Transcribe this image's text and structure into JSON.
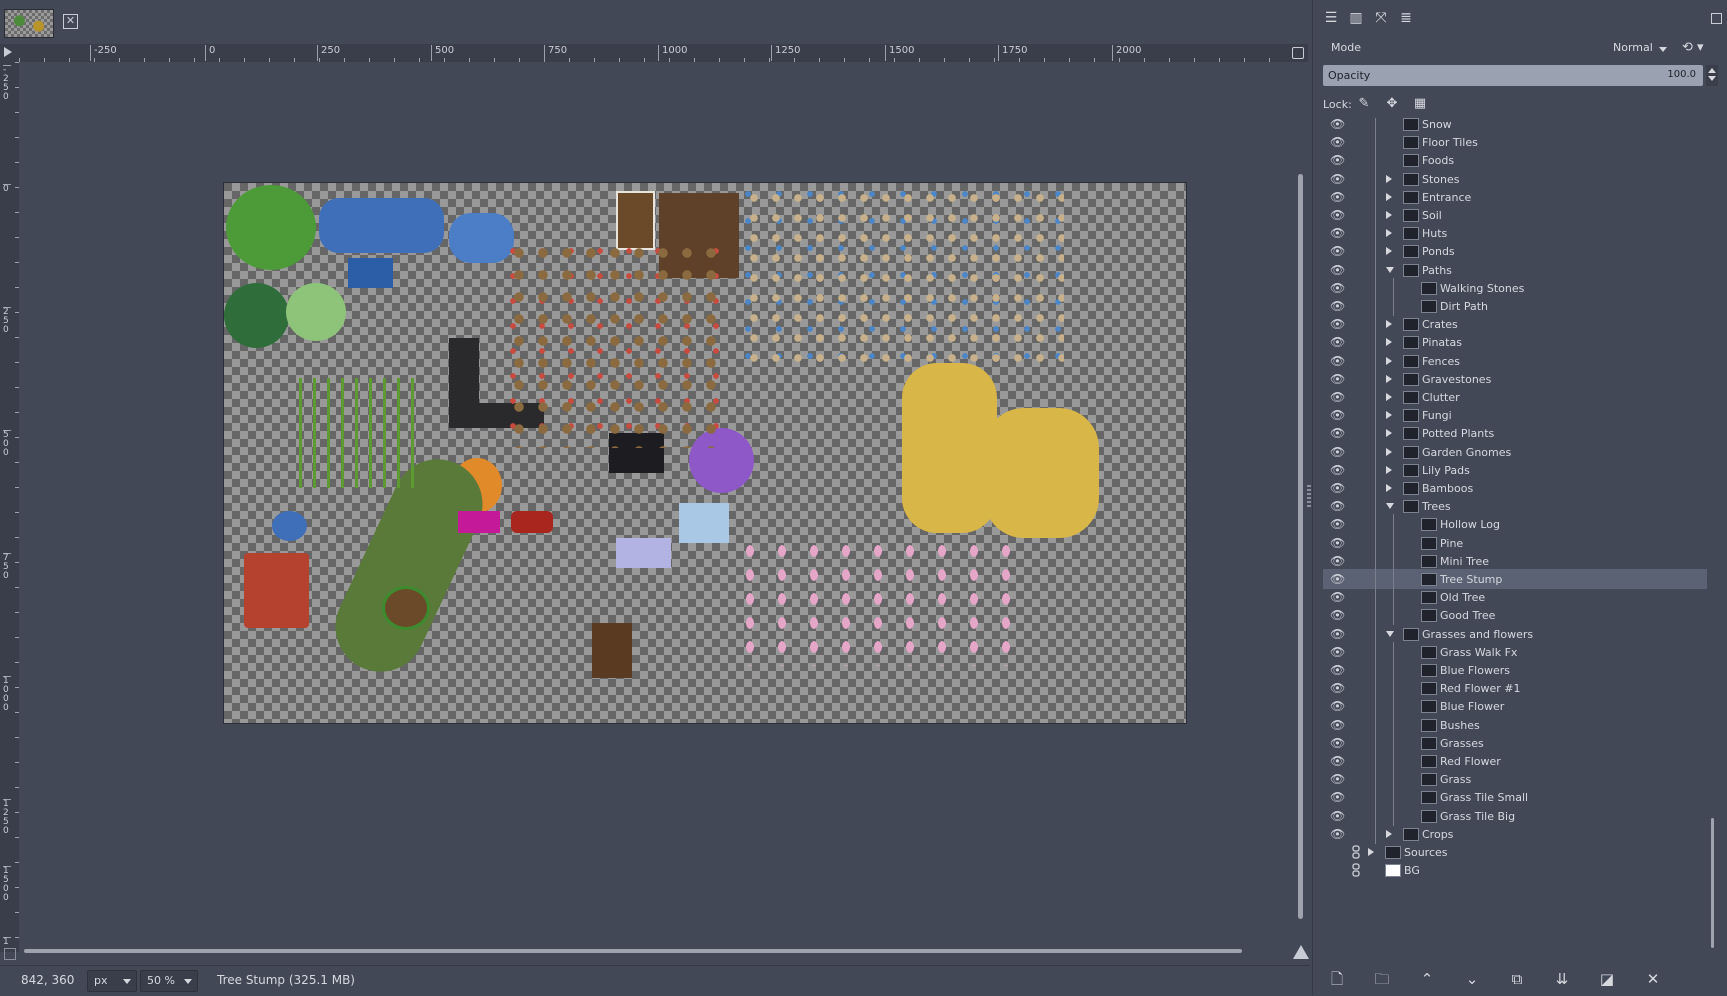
{
  "tab": {
    "close_icon": "close-icon"
  },
  "ruler": {
    "horizontal": [
      "-250",
      "0",
      "250",
      "500",
      "750",
      "1000",
      "1250",
      "1500",
      "1750",
      "2000"
    ],
    "vertical": [
      "-250",
      "0",
      "250",
      "500",
      "750",
      "1000",
      "1250",
      "1500",
      "1"
    ]
  },
  "statusbar": {
    "coords": "842, 360",
    "unit": "px",
    "zoom": "50 %",
    "message": "Tree Stump (325.1 MB)"
  },
  "layers_panel": {
    "mode_label": "Mode",
    "mode_value": "Normal",
    "opacity_label": "Opacity",
    "opacity_value": "100.0",
    "lock_label": "Lock:",
    "layers": [
      {
        "name": "Snow",
        "depth": 1,
        "kind": "layer",
        "expander": "none"
      },
      {
        "name": "Floor Tiles",
        "depth": 1,
        "kind": "layer",
        "expander": "none"
      },
      {
        "name": "Foods",
        "depth": 1,
        "kind": "layer",
        "expander": "none"
      },
      {
        "name": "Stones",
        "depth": 1,
        "kind": "group",
        "expander": "closed"
      },
      {
        "name": "Entrance",
        "depth": 1,
        "kind": "group",
        "expander": "closed"
      },
      {
        "name": "Soil",
        "depth": 1,
        "kind": "group",
        "expander": "closed"
      },
      {
        "name": "Huts",
        "depth": 1,
        "kind": "group",
        "expander": "closed"
      },
      {
        "name": "Ponds",
        "depth": 1,
        "kind": "group",
        "expander": "closed"
      },
      {
        "name": "Paths",
        "depth": 1,
        "kind": "group",
        "expander": "open"
      },
      {
        "name": "Walking Stones",
        "depth": 2,
        "kind": "layer",
        "expander": "none"
      },
      {
        "name": "Dirt Path",
        "depth": 2,
        "kind": "layer",
        "expander": "none"
      },
      {
        "name": "Crates",
        "depth": 1,
        "kind": "group",
        "expander": "closed"
      },
      {
        "name": "Pinatas",
        "depth": 1,
        "kind": "group",
        "expander": "closed"
      },
      {
        "name": "Fences",
        "depth": 1,
        "kind": "group",
        "expander": "closed"
      },
      {
        "name": "Gravestones",
        "depth": 1,
        "kind": "group",
        "expander": "closed"
      },
      {
        "name": "Clutter",
        "depth": 1,
        "kind": "group",
        "expander": "closed"
      },
      {
        "name": "Fungi",
        "depth": 1,
        "kind": "group",
        "expander": "closed"
      },
      {
        "name": "Potted Plants",
        "depth": 1,
        "kind": "group",
        "expander": "closed"
      },
      {
        "name": "Garden Gnomes",
        "depth": 1,
        "kind": "group",
        "expander": "closed"
      },
      {
        "name": "Lily Pads",
        "depth": 1,
        "kind": "group",
        "expander": "closed"
      },
      {
        "name": "Bamboos",
        "depth": 1,
        "kind": "group",
        "expander": "closed"
      },
      {
        "name": "Trees",
        "depth": 1,
        "kind": "group",
        "expander": "open"
      },
      {
        "name": "Hollow Log",
        "depth": 2,
        "kind": "layer",
        "expander": "none"
      },
      {
        "name": "Pine",
        "depth": 2,
        "kind": "layer",
        "expander": "none"
      },
      {
        "name": "Mini Tree",
        "depth": 2,
        "kind": "layer",
        "expander": "none"
      },
      {
        "name": "Tree Stump",
        "depth": 2,
        "kind": "layer",
        "expander": "none",
        "selected": true
      },
      {
        "name": "Old Tree",
        "depth": 2,
        "kind": "layer",
        "expander": "none"
      },
      {
        "name": "Good Tree",
        "depth": 2,
        "kind": "layer",
        "expander": "none"
      },
      {
        "name": "Grasses and flowers",
        "depth": 1,
        "kind": "group",
        "expander": "open"
      },
      {
        "name": "Grass Walk Fx",
        "depth": 2,
        "kind": "layer",
        "expander": "none"
      },
      {
        "name": "Blue Flowers",
        "depth": 2,
        "kind": "layer",
        "expander": "none"
      },
      {
        "name": "Red Flower #1",
        "depth": 2,
        "kind": "layer",
        "expander": "none"
      },
      {
        "name": "Blue Flower",
        "depth": 2,
        "kind": "layer",
        "expander": "none"
      },
      {
        "name": "Bushes",
        "depth": 2,
        "kind": "layer",
        "expander": "none"
      },
      {
        "name": "Grasses",
        "depth": 2,
        "kind": "layer",
        "expander": "none"
      },
      {
        "name": "Red Flower",
        "depth": 2,
        "kind": "layer",
        "expander": "none"
      },
      {
        "name": "Grass",
        "depth": 2,
        "kind": "layer",
        "expander": "none"
      },
      {
        "name": "Grass Tile Small",
        "depth": 2,
        "kind": "layer",
        "expander": "none"
      },
      {
        "name": "Grass Tile Big",
        "depth": 2,
        "kind": "layer",
        "expander": "none"
      },
      {
        "name": "Crops",
        "depth": 1,
        "kind": "group",
        "expander": "closed"
      },
      {
        "name": "Sources",
        "depth": 0,
        "kind": "group",
        "expander": "closed",
        "hidden": true
      },
      {
        "name": "BG",
        "depth": 0,
        "kind": "white",
        "expander": "none",
        "hidden": true
      }
    ]
  },
  "colors": {
    "background": "#434857",
    "selected_row": "#5b6274",
    "opacity_bar": "#9aa1b0"
  }
}
